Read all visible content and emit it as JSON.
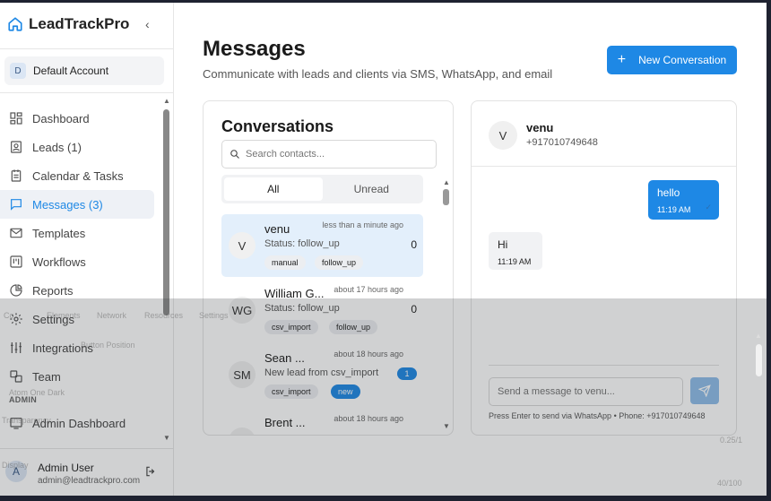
{
  "brand": {
    "name": "LeadTrackPro",
    "collapse_icon": "chevron-left-icon"
  },
  "account": {
    "initial": "D",
    "name": "Default Account"
  },
  "nav": {
    "items": [
      {
        "label": "Dashboard",
        "icon": "dashboard-icon"
      },
      {
        "label": "Leads (1)",
        "icon": "leads-icon"
      },
      {
        "label": "Calendar & Tasks",
        "icon": "calendar-icon"
      },
      {
        "label": "Messages (3)",
        "icon": "message-icon",
        "active": true
      },
      {
        "label": "Templates",
        "icon": "mail-icon"
      },
      {
        "label": "Workflows",
        "icon": "workflow-icon"
      },
      {
        "label": "Reports",
        "icon": "pie-chart-icon"
      },
      {
        "label": "Settings",
        "icon": "gear-icon"
      },
      {
        "label": "Integrations",
        "icon": "sliders-icon"
      },
      {
        "label": "Team",
        "icon": "team-icon"
      }
    ],
    "admin_section": "ADMIN",
    "admin_items": [
      {
        "label": "Admin Dashboard",
        "icon": "admin-icon"
      }
    ]
  },
  "user": {
    "initial": "A",
    "name": "Admin User",
    "email": "admin@leadtrackpro.com"
  },
  "header": {
    "title": "Messages",
    "subtitle": "Communicate with leads and clients via SMS, WhatsApp, and email",
    "new_button": "New Conversation"
  },
  "conversations": {
    "title": "Conversations",
    "search_placeholder": "Search contacts...",
    "tabs": [
      "All",
      "Unread"
    ],
    "items": [
      {
        "initials": "V",
        "name": "venu",
        "time": "less than a minute ago",
        "status": "Status: follow_up",
        "count": "0",
        "tags": [
          "manual",
          "follow_up"
        ],
        "selected": true
      },
      {
        "initials": "WG",
        "name": "William G...",
        "time": "about 17 hours ago",
        "status": "Status: follow_up",
        "count": "0",
        "tags": [
          "csv_import",
          "follow_up"
        ]
      },
      {
        "initials": "SM",
        "name": "Sean ...",
        "time": "about 18 hours ago",
        "status": "New lead from csv_import",
        "unread": "1",
        "tags": [
          "csv_import",
          "new"
        ]
      },
      {
        "initials": "",
        "name": "Brent ...",
        "time": "about 18 hours ago",
        "status": "",
        "tags": []
      }
    ]
  },
  "chat": {
    "contact_initial": "V",
    "contact_name": "venu",
    "contact_phone": "+917010749648",
    "messages": [
      {
        "direction": "out",
        "text": "hello",
        "time": "11:19 AM"
      },
      {
        "direction": "in",
        "text": "Hi",
        "time": "11:19 AM"
      }
    ],
    "input_placeholder": "Send a message to venu...",
    "hint": "Press Enter to send via WhatsApp • Phone: +917010749648"
  },
  "devtools_overlay": {
    "tabs": [
      "Co...",
      "Elements",
      "Network",
      "Resources",
      "Settings"
    ],
    "options": [
      "Button Position",
      "Atom One Dark",
      "Transparency",
      "Display"
    ],
    "readouts": [
      "0.25/1",
      "40/100"
    ]
  }
}
